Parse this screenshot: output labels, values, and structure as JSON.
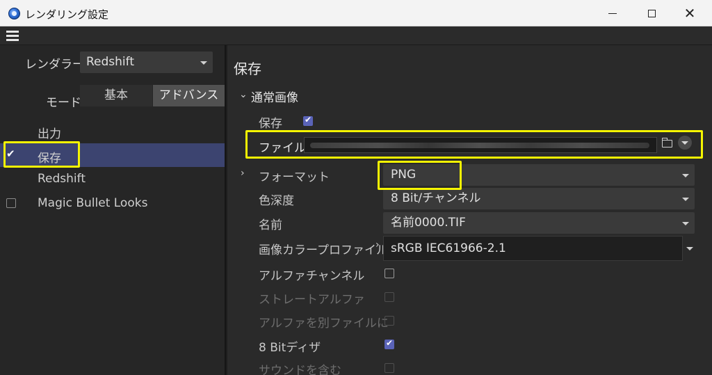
{
  "window": {
    "title": "レンダリング設定",
    "minimize": "minimize",
    "maximize": "maximize",
    "close": "✕"
  },
  "left": {
    "renderer_label": "レンダラー",
    "renderer_value": "Redshift",
    "mode_label": "モード",
    "mode_basic": "基本",
    "mode_advanced": "アドバンス",
    "nav": [
      {
        "label": "出力",
        "checkbox": false,
        "checked": false
      },
      {
        "label": "保存",
        "checkbox": true,
        "checked": true
      },
      {
        "label": "Redshift",
        "checkbox": false,
        "checked": false
      },
      {
        "label": "Magic Bullet Looks",
        "checkbox": true,
        "checked": false
      }
    ]
  },
  "right": {
    "section_title": "保存",
    "group_title": "通常画像",
    "save_label": "保存",
    "save_checked": true,
    "file_label": "ファイル",
    "format_label": "フォーマット",
    "format_value": "PNG",
    "depth_label": "色深度",
    "depth_value": "8 Bit/チャンネル",
    "name_label": "名前",
    "name_value": "名前0000.TIF",
    "profile_label": "画像カラープロファイル",
    "profile_value": "sRGB IEC61966-2.1",
    "alpha_label": "アルファチャンネル",
    "alpha_checked": false,
    "straight_alpha_label": "ストレートアルファ",
    "straight_alpha_checked": false,
    "separate_alpha_label": "アルファを別ファイルに",
    "separate_alpha_checked": false,
    "dither_label": "8 Bitディザ",
    "dither_checked": true,
    "sound_label": "サウンドを含む",
    "sound_checked": false
  },
  "colors": {
    "highlight": "#f5f500",
    "accent": "#5a63b8",
    "active_nav": "#3c4470"
  }
}
